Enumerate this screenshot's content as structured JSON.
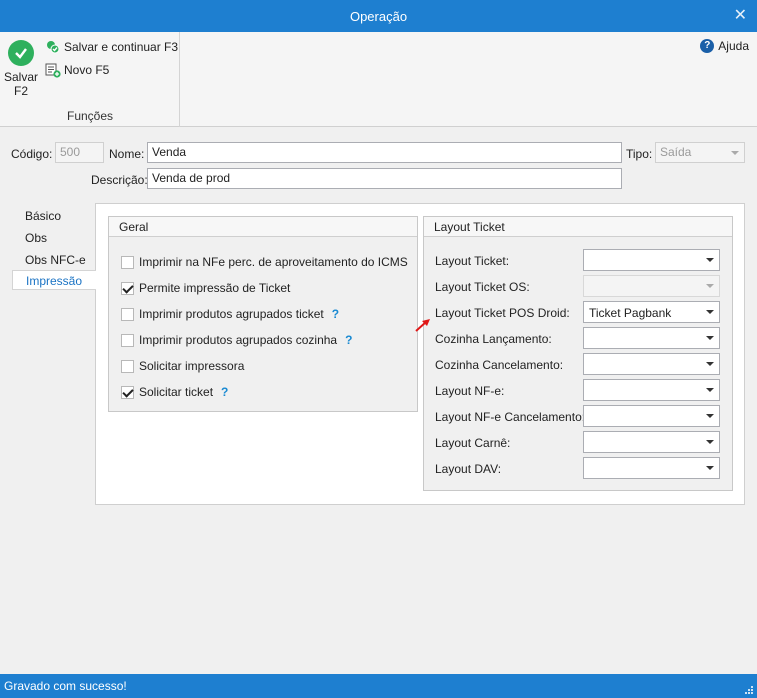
{
  "window": {
    "title": "Operação",
    "close_label": "✕"
  },
  "ribbon": {
    "save_label": "Salvar\nF2",
    "save_continue_label": "Salvar e continuar F3",
    "new_label": "Novo F5",
    "group_label": "Funções",
    "help_label": "Ajuda"
  },
  "form": {
    "codigo_label": "Código:",
    "codigo_value": "500",
    "nome_label": "Nome:",
    "nome_value": "Venda",
    "tipo_label": "Tipo:",
    "tipo_value": "Saída",
    "descricao_label": "Descrição:",
    "descricao_value": "Venda de prod"
  },
  "tabs": [
    {
      "label": "Básico"
    },
    {
      "label": "Obs"
    },
    {
      "label": "Obs NFC-e"
    },
    {
      "label": "Impressão",
      "active": true
    }
  ],
  "geral": {
    "title": "Geral",
    "options": [
      {
        "label": "Imprimir na NFe perc. de aproveitamento do ICMS",
        "checked": false,
        "help": false
      },
      {
        "label": "Permite impressão de Ticket",
        "checked": true,
        "help": false
      },
      {
        "label": "Imprimir produtos agrupados ticket",
        "checked": false,
        "help": true
      },
      {
        "label": "Imprimir produtos agrupados cozinha",
        "checked": false,
        "help": true
      },
      {
        "label": "Solicitar impressora",
        "checked": false,
        "help": false
      },
      {
        "label": "Solicitar ticket",
        "checked": true,
        "help": true
      }
    ],
    "help_symbol": "?"
  },
  "layout_ticket": {
    "title": "Layout Ticket",
    "rows": [
      {
        "label": "Layout Ticket:",
        "value": "",
        "disabled": false
      },
      {
        "label": "Layout Ticket OS:",
        "value": "",
        "disabled": true
      },
      {
        "label": "Layout Ticket POS Droid:",
        "value": "Ticket Pagbank",
        "disabled": false
      },
      {
        "label": "Cozinha Lançamento:",
        "value": "",
        "disabled": false
      },
      {
        "label": "Cozinha Cancelamento:",
        "value": "",
        "disabled": false
      },
      {
        "label": "Layout NF-e:",
        "value": "",
        "disabled": false
      },
      {
        "label": "Layout NF-e Cancelamento:",
        "value": "",
        "disabled": false
      },
      {
        "label": "Layout Carnê:",
        "value": "",
        "disabled": false
      },
      {
        "label": "Layout DAV:",
        "value": "",
        "disabled": false
      }
    ]
  },
  "status": {
    "message": "Gravado com sucesso!"
  },
  "colors": {
    "accent": "#1e7fd0",
    "success": "#2eb05d",
    "link": "#1a73c4"
  }
}
